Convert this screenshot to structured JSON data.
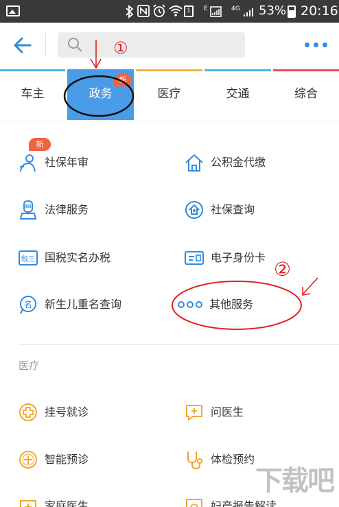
{
  "status_bar": {
    "battery_percent": "53%",
    "time": "20:16",
    "network_type": "4G",
    "sim_slot": "1",
    "icon_names": [
      "image-notification-icon",
      "bluetooth-icon",
      "nfc-icon",
      "alarm-icon",
      "wifi-icon",
      "signal-icon",
      "battery-icon"
    ]
  },
  "header": {
    "search_placeholder": "",
    "accent_color": "#2e8bdf"
  },
  "tabs": {
    "items": [
      {
        "label": "车主",
        "line_color": "#4fb0e6"
      },
      {
        "label": "政务",
        "line_color": "#4a9be8",
        "active": true,
        "badge": "新"
      },
      {
        "label": "医疗",
        "line_color": "#f0b23c"
      },
      {
        "label": "交通",
        "line_color": "#4fb0e6"
      },
      {
        "label": "综合",
        "line_color": "#e94b4b"
      }
    ]
  },
  "government_services": {
    "badge": "新",
    "items": [
      {
        "label": "社保年审",
        "icon": "person-icon"
      },
      {
        "label": "公积金代缴",
        "icon": "house-icon"
      },
      {
        "label": "法律服务",
        "icon": "lawyer-icon"
      },
      {
        "label": "社保查询",
        "icon": "social-security-icon"
      },
      {
        "label": "国税实名办税",
        "icon": "tax-icon",
        "icon_text": "税三"
      },
      {
        "label": "电子身份卡",
        "icon": "id-card-icon"
      },
      {
        "label": "新生儿重名查询",
        "icon": "name-search-icon",
        "icon_text": "名"
      },
      {
        "label": "其他服务",
        "icon": "more-dots-icon"
      }
    ]
  },
  "medical_section": {
    "title": "医疗",
    "items": [
      {
        "label": "挂号就诊",
        "icon": "medical-cross-icon"
      },
      {
        "label": "问医生",
        "icon": "chat-doctor-icon"
      },
      {
        "label": "智能预诊",
        "icon": "smart-diagnosis-icon"
      },
      {
        "label": "体检预约",
        "icon": "stethoscope-icon"
      },
      {
        "label": "家庭医生",
        "icon": "family-doctor-icon"
      },
      {
        "label": "妇产报告解读",
        "icon": "report-icon"
      }
    ]
  },
  "annotations": {
    "mark_1": "①",
    "mark_2": "②",
    "color": "#e02020"
  },
  "watermark": {
    "text": "下载吧"
  }
}
